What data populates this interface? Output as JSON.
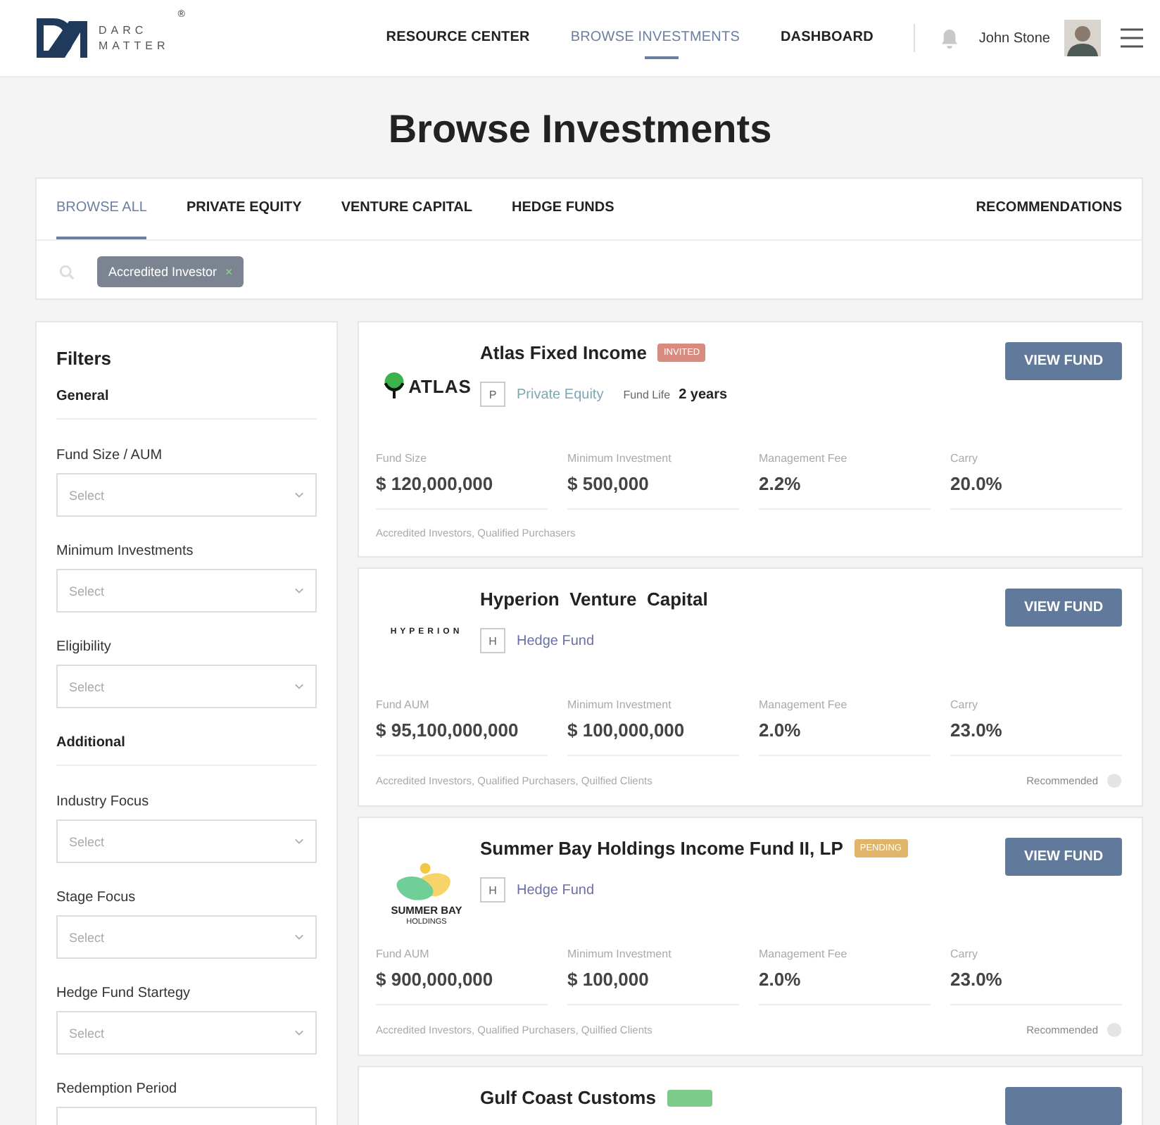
{
  "header": {
    "logo": {
      "line1": "DARC",
      "line2": "MATTER",
      "mark": "®"
    },
    "nav": [
      {
        "label": "RESOURCE CENTER",
        "selected": false
      },
      {
        "label": "BROWSE INVESTMENTS",
        "selected": true
      },
      {
        "label": "DASHBOARD",
        "selected": false
      }
    ],
    "user": {
      "name": "John Stone"
    }
  },
  "page_title": "Browse Investments",
  "tabs": [
    {
      "label": "BROWSE ALL",
      "selected": true
    },
    {
      "label": "PRIVATE EQUITY",
      "selected": false
    },
    {
      "label": "VENTURE CAPITAL",
      "selected": false
    },
    {
      "label": "HEDGE FUNDS",
      "selected": false
    }
  ],
  "recommendations": "RECOMMENDATIONS",
  "active_filters": [
    {
      "label": "Accredited Investor",
      "remove": "×"
    }
  ],
  "filters": {
    "title": "Filters",
    "items": [
      {
        "kind": "heading",
        "label": "General"
      },
      {
        "kind": "select",
        "label": "Fund Size / AUM",
        "placeholder": "Select"
      },
      {
        "kind": "select",
        "label": "Minimum Investments",
        "placeholder": "Select"
      },
      {
        "kind": "select",
        "label": "Eligibility",
        "placeholder": "Select"
      },
      {
        "kind": "heading",
        "label": "Additional"
      },
      {
        "kind": "select",
        "label": "Industry Focus",
        "placeholder": "Select"
      },
      {
        "kind": "select",
        "label": "Stage Focus",
        "placeholder": "Select"
      },
      {
        "kind": "select",
        "label": "Hedge Fund Startegy",
        "placeholder": "Select"
      },
      {
        "kind": "select",
        "label": "Redemption Period"
      }
    ]
  },
  "funds": [
    {
      "logo": {
        "kind": "atlas",
        "text": "ATLAS"
      },
      "name": "Atlas Fixed Income",
      "badge": {
        "label": "INVITED",
        "color": "#d98b80"
      },
      "type": {
        "letter": "P",
        "label": "Private Equity",
        "color": "#7fa7b5"
      },
      "fund_life_label": "Fund Life",
      "fund_life": "2 years",
      "metrics": [
        {
          "label": "Fund Size",
          "value": "$ 120,000,000"
        },
        {
          "label": "Minimum Investment",
          "value": "$ 500,000"
        },
        {
          "label": "Management Fee",
          "value": "2.2%"
        },
        {
          "label": "Carry",
          "value": "20.0%"
        }
      ],
      "eligibility": "Accredited Investors, Qualified Purchasers",
      "button": "VIEW FUND"
    },
    {
      "logo": {
        "kind": "wordmark",
        "text": "HYPERION"
      },
      "name": "Hyperion  Venture  Capital",
      "type": {
        "letter": "H",
        "label": "Hedge Fund",
        "color": "#6b6fa6"
      },
      "metrics": [
        {
          "label": "Fund AUM",
          "value": "$ 95,100,000,000"
        },
        {
          "label": "Minimum Investment",
          "value": "$ 100,000,000"
        },
        {
          "label": "Management Fee",
          "value": "2.0%"
        },
        {
          "label": "Carry",
          "value": "23.0%"
        }
      ],
      "eligibility": "Accredited Investors, Qualified Purchasers, Quilfied Clients",
      "recommended": "Recommended",
      "button": "VIEW FUND"
    },
    {
      "logo": {
        "kind": "summerbay",
        "text": "SUMMER BAY",
        "subtext": "HOLDINGS"
      },
      "name": "Summer Bay Holdings Income Fund II, LP",
      "badge": {
        "label": "PENDING",
        "color": "#e0b46a"
      },
      "type": {
        "letter": "H",
        "label": "Hedge Fund",
        "color": "#6b6fa6"
      },
      "metrics": [
        {
          "label": "Fund AUM",
          "value": "$ 900,000,000"
        },
        {
          "label": "Minimum Investment",
          "value": "$ 100,000"
        },
        {
          "label": "Management Fee",
          "value": "2.0%"
        },
        {
          "label": "Carry",
          "value": "23.0%"
        }
      ],
      "eligibility": "Accredited Investors, Qualified Purchasers, Quilfied Clients",
      "recommended": "Recommended",
      "button": "VIEW FUND"
    },
    {
      "name": "Gulf Coast Customs",
      "badge": {
        "color": "#7cc98a"
      }
    }
  ]
}
